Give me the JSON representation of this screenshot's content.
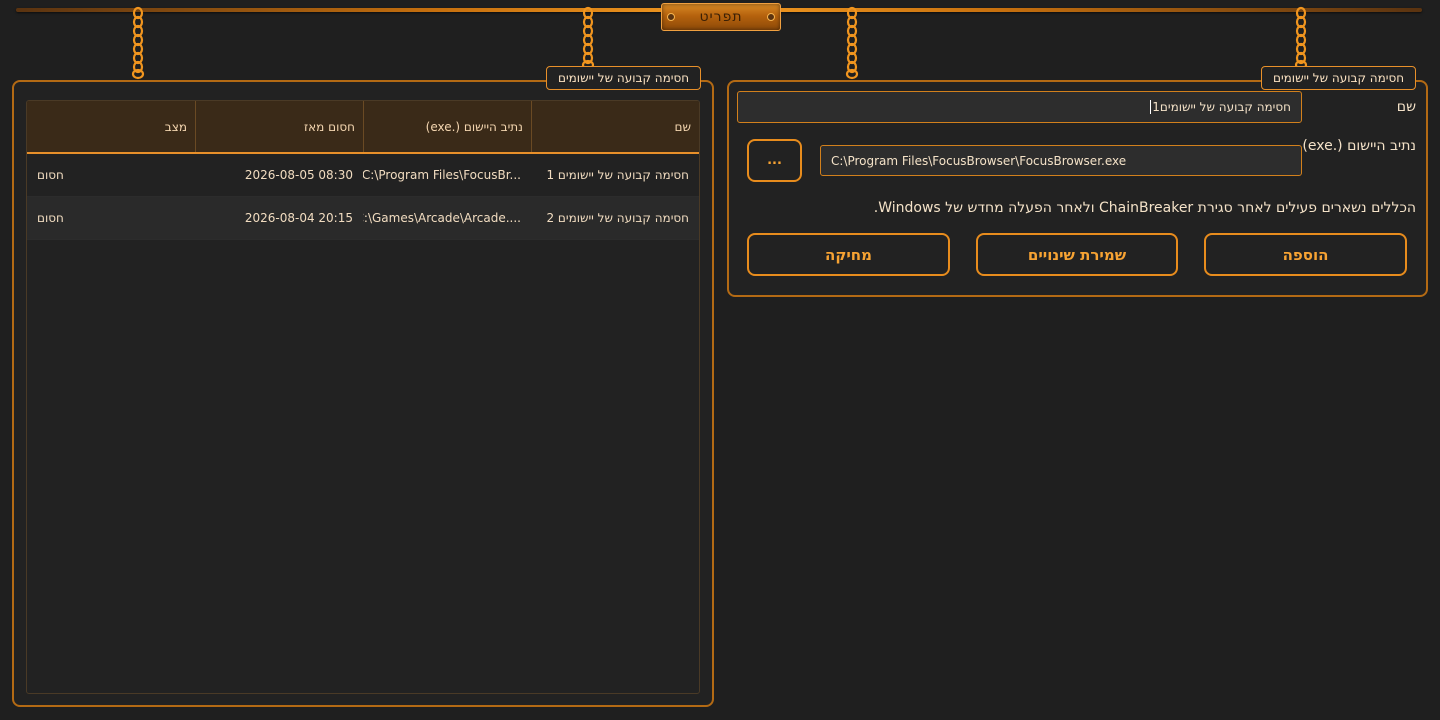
{
  "menu": {
    "label": "תפריט"
  },
  "left_panel": {
    "title": "חסימה קבועה של יישומים",
    "table": {
      "headers": [
        "שם",
        "נתיב היישום (.exe)",
        "חסום מאז",
        "מצב"
      ],
      "rows": [
        {
          "name": "חסימה קבועה של יישומים 1",
          "path": "C:\\Program Files\\FocusBr...",
          "since": "2026-08-05 08:30",
          "status": "חסום"
        },
        {
          "name": "חסימה קבועה של יישומים 2",
          "path": "C:\\Games\\Arcade\\Arcade....",
          "since": "2026-08-04 20:15",
          "status": "חסום"
        }
      ]
    }
  },
  "right_panel": {
    "title": "חסימה קבועה של יישומים",
    "name_label": "שם",
    "name_value": "חסימה קבועה של יישומים1",
    "path_label": "נתיב היישום (.exe)",
    "path_value": "C:\\Program Files\\FocusBrowser\\FocusBrowser.exe",
    "browse_label": "...",
    "note": "הכללים נשארים פעילים לאחר סגירת ChainBreaker ולאחר הפעלה מחדש של Windows.",
    "buttons": {
      "add": "הוספה",
      "save": "שמירת שינויים",
      "delete": "מחיקה"
    }
  },
  "colors": {
    "accent": "#e88c1d",
    "background": "#1f1f1f",
    "text": "#f4e2c8"
  }
}
